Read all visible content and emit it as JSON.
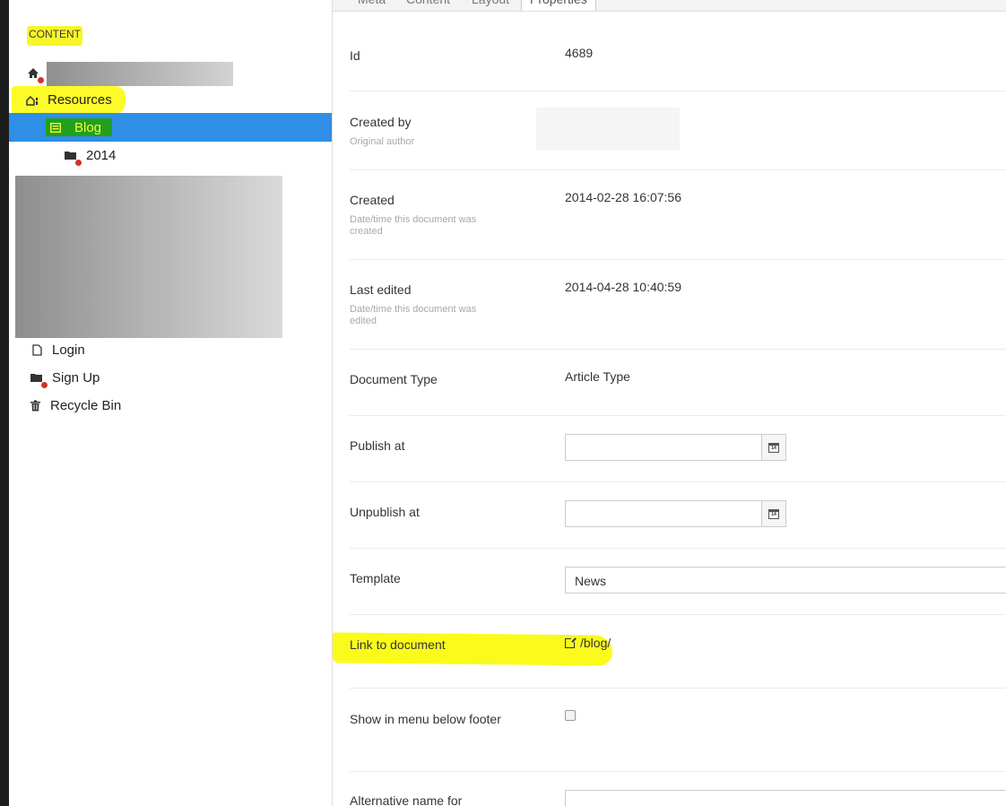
{
  "sidebar": {
    "section_title": "CONTENT",
    "items": {
      "resources": "Resources",
      "blog": "Blog",
      "year": "2014",
      "login": "Login",
      "signup": "Sign Up",
      "recycle": "Recycle Bin"
    },
    "icons": {
      "root": "home-icon",
      "resources": "resources-icon",
      "blog": "list-page-icon",
      "year": "folder-icon",
      "login": "document-icon",
      "signup": "folder-icon",
      "recycle": "trash-icon"
    }
  },
  "tabs": [
    "Meta",
    "Content",
    "Layout",
    "Properties"
  ],
  "active_tab": "Properties",
  "properties": {
    "id": {
      "label": "Id",
      "value": "4689"
    },
    "created_by": {
      "label": "Created by",
      "desc": "Original author"
    },
    "created": {
      "label": "Created",
      "desc": "Date/time this document was created",
      "value": "2014-02-28 16:07:56"
    },
    "last_edited": {
      "label": "Last edited",
      "desc": "Date/time this document was edited",
      "value": "2014-04-28 10:40:59"
    },
    "document_type": {
      "label": "Document Type",
      "value": "Article Type"
    },
    "publish_at": {
      "label": "Publish at",
      "value": ""
    },
    "unpublish_at": {
      "label": "Unpublish at",
      "value": ""
    },
    "template": {
      "label": "Template",
      "value": "News"
    },
    "link": {
      "label": "Link to document",
      "value": "/blog/"
    },
    "show_in_menu": {
      "label": "Show in menu below footer",
      "checked": false
    },
    "alt_name": {
      "label": "Alternative name for"
    }
  },
  "colors": {
    "selected_node": "#2f8ee5",
    "highlight_yellow": "#fbfb2a",
    "highlight_green": "#22a01c"
  }
}
